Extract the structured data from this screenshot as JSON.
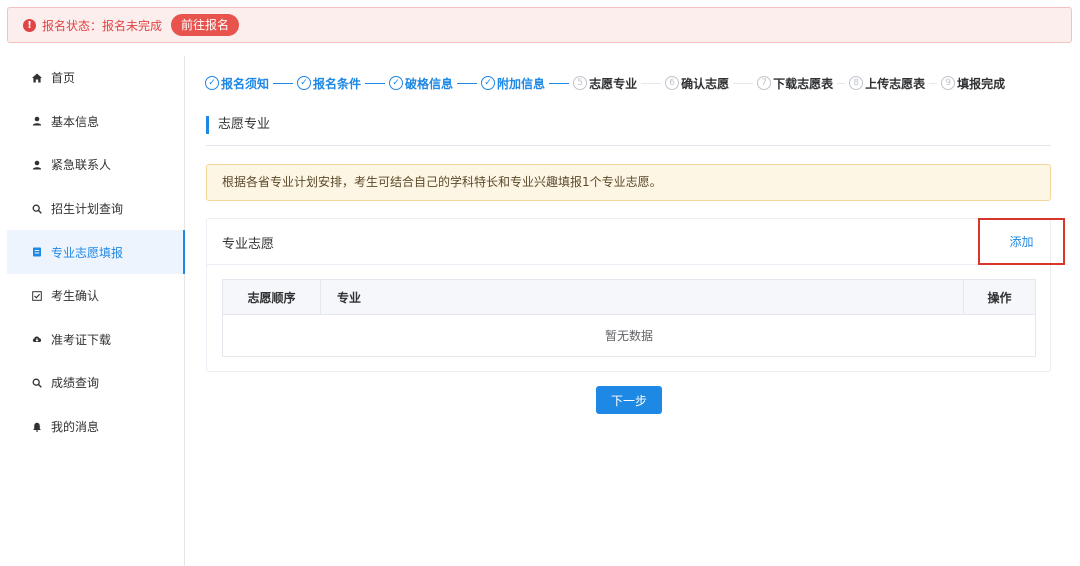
{
  "alert": {
    "status_text": "报名状态：报名未完成",
    "button_label": "前往报名"
  },
  "sidebar": {
    "items": [
      {
        "label": "首页",
        "icon": "home-icon"
      },
      {
        "label": "基本信息",
        "icon": "user-icon"
      },
      {
        "label": "紧急联系人",
        "icon": "user-icon"
      },
      {
        "label": "招生计划查询",
        "icon": "search-icon"
      },
      {
        "label": "专业志愿填报",
        "icon": "document-icon",
        "active": true
      },
      {
        "label": "考生确认",
        "icon": "checkbox-icon"
      },
      {
        "label": "准考证下载",
        "icon": "cloud-download-icon"
      },
      {
        "label": "成绩查询",
        "icon": "search-icon"
      },
      {
        "label": "我的消息",
        "icon": "bell-icon"
      }
    ]
  },
  "steps": [
    {
      "num": "✓",
      "label": "报名须知",
      "done": true
    },
    {
      "num": "✓",
      "label": "报名条件",
      "done": true
    },
    {
      "num": "✓",
      "label": "破格信息",
      "done": true
    },
    {
      "num": "✓",
      "label": "附加信息",
      "done": true
    },
    {
      "num": "5",
      "label": "志愿专业",
      "done": false
    },
    {
      "num": "6",
      "label": "确认志愿",
      "done": false
    },
    {
      "num": "7",
      "label": "下载志愿表",
      "done": false
    },
    {
      "num": "8",
      "label": "上传志愿表",
      "done": false
    },
    {
      "num": "9",
      "label": "填报完成",
      "done": false
    }
  ],
  "section": {
    "title": "志愿专业"
  },
  "notice": {
    "text": "根据各省专业计划安排，考生可结合自己的学科特长和专业兴趣填报1个专业志愿。"
  },
  "card": {
    "title": "专业志愿",
    "add_label": "添加",
    "columns": [
      "志愿顺序",
      "专业",
      "操作"
    ],
    "empty_text": "暂无数据"
  },
  "next_button": "下一步",
  "colors": {
    "accent": "#1e88e5",
    "alert": "#e04444",
    "highlight_box": "#d9362b"
  }
}
